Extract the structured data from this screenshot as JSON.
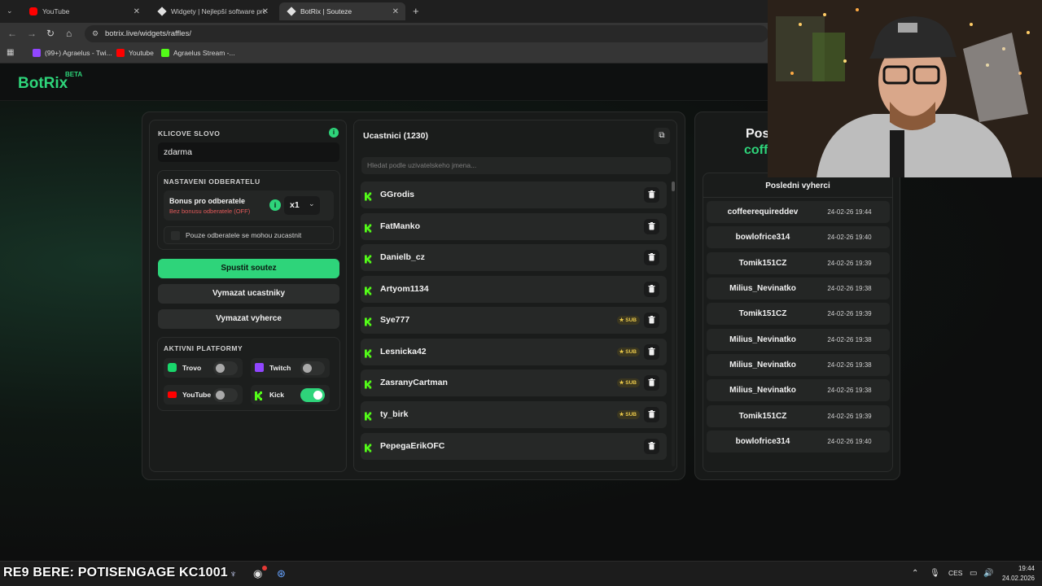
{
  "browser": {
    "tabs": [
      {
        "label": "YouTube",
        "active": false
      },
      {
        "label": "Widgety | Nejlepší software pro",
        "active": false
      },
      {
        "label": "BotRix | Souteze",
        "active": true
      }
    ],
    "url": "botrix.live/widgets/raffles/",
    "bookmarks": [
      "(99+) Agraelus - Twi...",
      "Youtube",
      "Agraelus Stream -..."
    ]
  },
  "app": {
    "logo": "BotRix",
    "beta": "BETA"
  },
  "left_panel": {
    "keyword_label": "KLICOVE SLOVO",
    "keyword_value": "zdarma",
    "subscriber_section": "NASTAVENI ODBERATELU",
    "bonus_title": "Bonus pro odberatele",
    "bonus_sub": "Bez bonusu odberatele (OFF)",
    "multiplier": "x1",
    "subs_only_label": "Pouze odberatele se mohou zucastnit",
    "start_button": "Spustit soutez",
    "clear_participants": "Vymazat ucastniky",
    "clear_winners": "Vymazat vyherce",
    "platforms_label": "AKTIVNI PLATFORMY",
    "platforms": [
      {
        "name": "Trovo",
        "enabled": false,
        "color": "#19d66b"
      },
      {
        "name": "Twitch",
        "enabled": false,
        "color": "#9146ff"
      },
      {
        "name": "YouTube",
        "enabled": false,
        "color": "#ff0000"
      },
      {
        "name": "Kick",
        "enabled": true,
        "color": "#53fc18"
      }
    ]
  },
  "participants": {
    "title": "Ucastnici (1230)",
    "search_placeholder": "Hledat podle uzivatelskeho jmena...",
    "sub_badge": "SUB",
    "list": [
      {
        "name": "GGrodis",
        "sub": false
      },
      {
        "name": "FatManko",
        "sub": false
      },
      {
        "name": "Danielb_cz",
        "sub": false
      },
      {
        "name": "Artyom1134",
        "sub": false
      },
      {
        "name": "Sye777",
        "sub": true
      },
      {
        "name": "Lesnicka42",
        "sub": true
      },
      {
        "name": "ZasranyCartman",
        "sub": true
      },
      {
        "name": "ty_birk",
        "sub": true
      },
      {
        "name": "PepegaErikOFC",
        "sub": false
      }
    ]
  },
  "winners": {
    "header_partial": "Pos",
    "header_name_partial": "coff",
    "title": "Posledni vyherci",
    "list": [
      {
        "name": "coffeerequireddev",
        "date": "24-02-26 19:44"
      },
      {
        "name": "bowlofrice314",
        "date": "24-02-26 19:40"
      },
      {
        "name": "Tomik151CZ",
        "date": "24-02-26 19:39"
      },
      {
        "name": "Milius_Nevinatko",
        "date": "24-02-26 19:38"
      },
      {
        "name": "Tomik151CZ",
        "date": "24-02-26 19:39"
      },
      {
        "name": "Milius_Nevinatko",
        "date": "24-02-26 19:38"
      },
      {
        "name": "Milius_Nevinatko",
        "date": "24-02-26 19:38"
      },
      {
        "name": "Milius_Nevinatko",
        "date": "24-02-26 19:38"
      },
      {
        "name": "Tomik151CZ",
        "date": "24-02-26 19:39"
      },
      {
        "name": "bowlofrice314",
        "date": "24-02-26 19:40"
      }
    ]
  },
  "taskbar": {
    "overlay": "RE9 BERE: POTISENGAGE KC1001",
    "language": "CES",
    "time": "19:44",
    "date": "24.02.2026"
  },
  "colors": {
    "accent": "#2ed47a",
    "kick": "#53fc18",
    "sub_badge": "#e9c84a"
  }
}
